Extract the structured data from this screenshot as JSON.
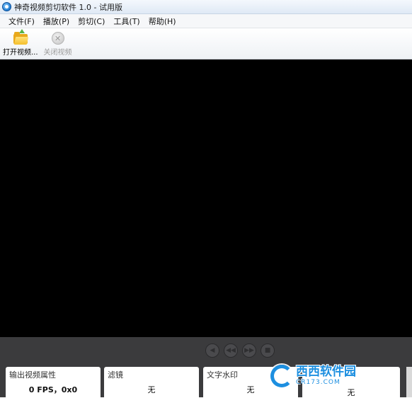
{
  "window": {
    "title": "神奇视频剪切软件 1.0 - 试用版",
    "icon": "app-logo-icon"
  },
  "menu": [
    {
      "label": "文件(F)"
    },
    {
      "label": "播放(P)"
    },
    {
      "label": "剪切(C)"
    },
    {
      "label": "工具(T)"
    },
    {
      "label": "帮助(H)"
    }
  ],
  "toolbar": {
    "open_video": {
      "label": "打开视频...",
      "icon": "open-folder-icon",
      "enabled": true
    },
    "close_video": {
      "label": "关闭视频",
      "icon": "close-circle-icon",
      "enabled": false
    }
  },
  "player_controls": [
    {
      "icon": "previous-icon",
      "glyph": "◀"
    },
    {
      "icon": "rewind-icon",
      "glyph": "◀◀"
    },
    {
      "icon": "forward-icon",
      "glyph": "▶▶"
    },
    {
      "icon": "stop-icon",
      "glyph": "■"
    }
  ],
  "properties": {
    "output": {
      "title": "输出视频属性",
      "value": "0 FPS，0x0"
    },
    "filter": {
      "title": "滤镜",
      "value": "无"
    },
    "text_watermark": {
      "title": "文字水印",
      "value": "无"
    },
    "fourth": {
      "value": "无"
    }
  },
  "watermark": {
    "main": "西西软件园",
    "sub": "CR173.COM"
  },
  "colors": {
    "video_bg": "#000000",
    "bottom_panel": "#3b3b3d",
    "accent_watermark": "#1d8fe0"
  }
}
